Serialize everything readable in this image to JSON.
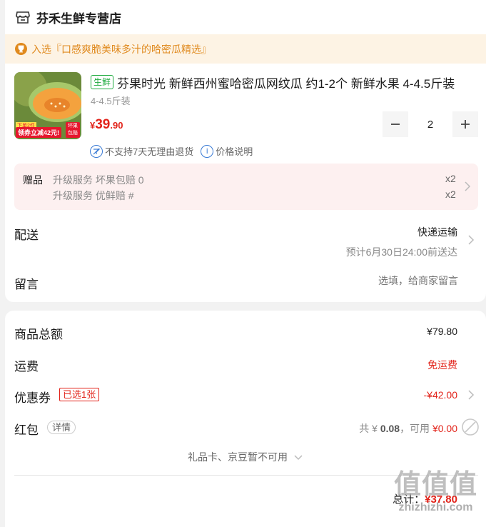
{
  "store": {
    "name": "芬禾生鲜专营店",
    "icon": "store-icon"
  },
  "promo": {
    "icon": "trophy-icon",
    "text": "入选『口感爽脆美味多汁的哈密瓜精选』"
  },
  "product": {
    "thumb_overlay_top": "下单2件",
    "thumb_overlay_bottom": "领券立减42元!",
    "thumb_badge": "坏果包赔",
    "tag": "生鲜",
    "title": "芬果时光 新鲜西州蜜哈密瓜网纹瓜 约1-2个 新鲜水果 4-4.5斤装",
    "spec": "4-4.5斤装",
    "price_symbol": "¥",
    "price_int": "39",
    "price_dec": ".90",
    "quantity": "2",
    "policy_no_return": "不支持7天无理由退货",
    "policy_price": "价格说明"
  },
  "gift": {
    "label": "赠品",
    "items": [
      {
        "name": "升级服务 坏果包赔 0",
        "qty": "x2"
      },
      {
        "name": "升级服务 优鲜赔 #",
        "qty": "x2"
      }
    ]
  },
  "delivery": {
    "label": "配送",
    "method": "快递运输",
    "eta": "预计6月30日24:00前送达"
  },
  "note": {
    "label": "留言",
    "placeholder": "选填，给商家留言"
  },
  "summary": {
    "goods_label": "商品总额",
    "goods_value": "¥79.80",
    "shipping_label": "运费",
    "shipping_value": "免运费",
    "coupon_label": "优惠券",
    "coupon_tag": "已选1张",
    "coupon_value": "-¥42.00",
    "redpacket_label": "红包",
    "redpacket_detail": "详情",
    "redpacket_total_prefix": "共 ¥ ",
    "redpacket_total": "0.08",
    "redpacket_usable_prefix": "，可用 ",
    "redpacket_usable": "¥0.00",
    "giftcard_text": "礼品卡、京豆暂不可用",
    "total_label": "总计：",
    "total_value": "¥37.80"
  },
  "watermark": {
    "logo": "值值值",
    "site": "zhizhizhi.com"
  },
  "colors": {
    "accent_red": "#e2231a",
    "promo_orange": "#e08a1e",
    "fresh_green": "#1eaa3e",
    "gift_bg": "#fdf0f0"
  }
}
